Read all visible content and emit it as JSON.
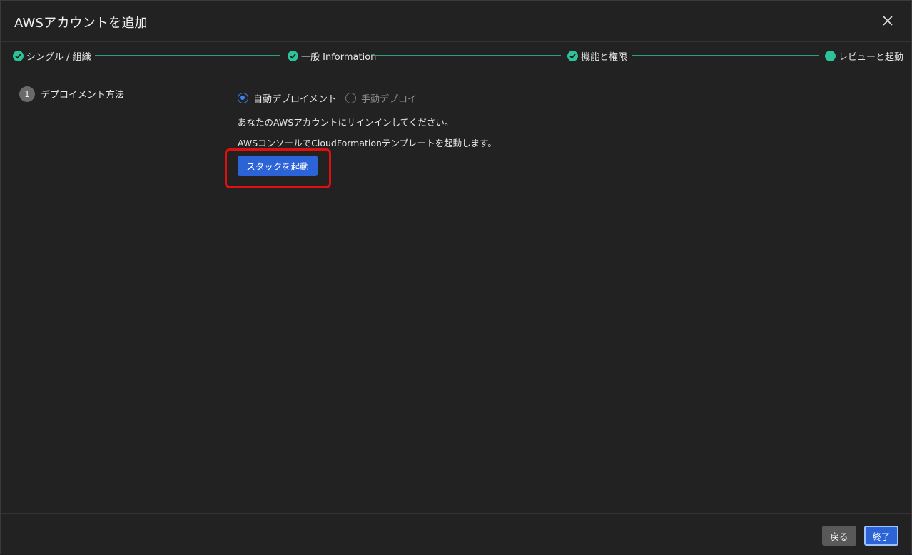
{
  "dialog": {
    "title": "AWSアカウントを追加",
    "close_icon": "close-icon"
  },
  "stepper": {
    "steps": [
      {
        "label": "シングル / 組織",
        "status": "complete"
      },
      {
        "label": "一般 Information",
        "status": "complete"
      },
      {
        "label": "機能と権限",
        "status": "complete"
      },
      {
        "label": "レビューと起動",
        "status": "current"
      }
    ],
    "accent_color": "#2cc29a"
  },
  "section": {
    "number": "1",
    "label": "デプロイメント方法",
    "options": [
      {
        "label": "自動デプロイメント",
        "selected": true
      },
      {
        "label": "手動デプロイ",
        "selected": false
      }
    ],
    "signin_text": "あなたのAWSアカウントにサインインしてください。",
    "console_text": "AWSコンソールでCloudFormationテンプレートを起動します。",
    "launch_button": "スタックを起動"
  },
  "footer": {
    "back_label": "戻る",
    "finish_label": "終了"
  },
  "colors": {
    "primary": "#2c64d8",
    "highlight": "#e01010"
  }
}
